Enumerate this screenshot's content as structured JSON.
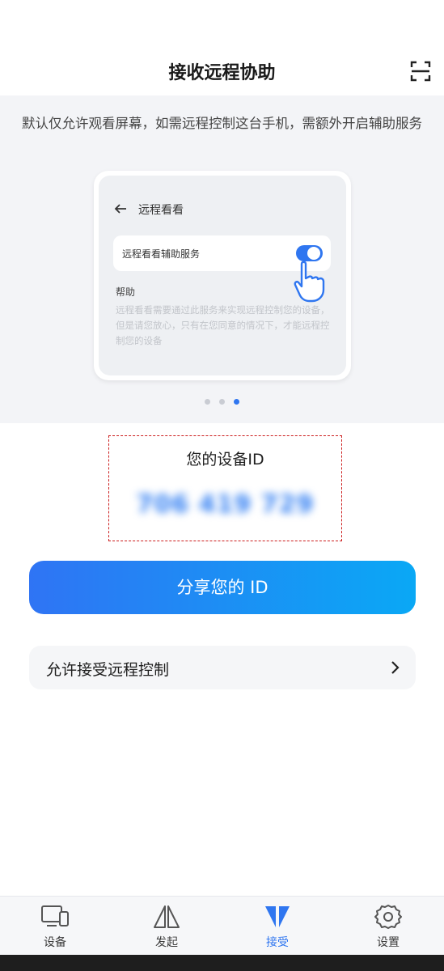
{
  "header": {
    "title": "接收远程协助",
    "scan_icon": "scan-icon"
  },
  "guide": {
    "description": "默认仅允许观看屏幕，如需远程控制这台手机，需额外开启辅助服务",
    "mock": {
      "title": "远程看看",
      "service_label": "远程看看辅助服务",
      "toggle_on": true,
      "help_title": "帮助",
      "help_text": "远程看看需要通过此服务来实现远程控制您的设备，但是请您放心，只有在您同意的情况下，才能远程控制您的设备"
    },
    "carousel": {
      "count": 3,
      "active_index": 2
    }
  },
  "device_id": {
    "label": "您的设备ID",
    "value": "706 419 729"
  },
  "share_button": {
    "label": "分享您的 ID"
  },
  "allow_row": {
    "label": "允许接受远程控制"
  },
  "tabbar": {
    "items": [
      {
        "label": "设备",
        "icon": "devices-icon",
        "active": false
      },
      {
        "label": "发起",
        "icon": "initiate-icon",
        "active": false
      },
      {
        "label": "接受",
        "icon": "receive-icon",
        "active": true
      },
      {
        "label": "设置",
        "icon": "settings-icon",
        "active": false
      }
    ]
  },
  "colors": {
    "accent": "#2f76f0",
    "gradient_start": "#2f74f4",
    "gradient_end": "#0aa8f5",
    "highlight_border": "#cc1e1e"
  }
}
